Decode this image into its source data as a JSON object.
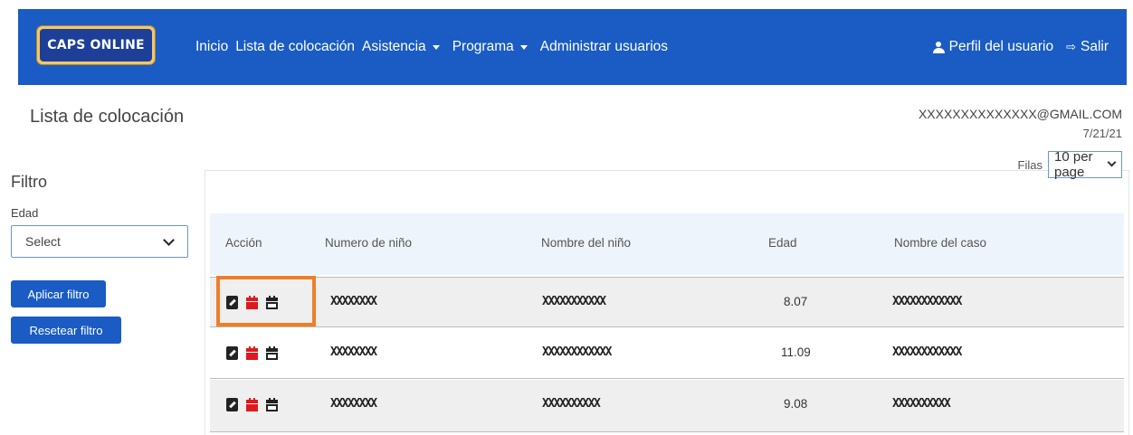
{
  "navbar": {
    "logo": "CAPS ONLINE",
    "links": [
      {
        "label": "Inicio",
        "dropdown": false
      },
      {
        "label": "Lista de colocación",
        "dropdown": false
      },
      {
        "label": "Asistencia",
        "dropdown": true
      },
      {
        "label": "Programa",
        "dropdown": true
      },
      {
        "label": "Administrar usuarios",
        "dropdown": false
      }
    ],
    "profile_label": "Perfil del usuario",
    "logout_label": "Salir",
    "color": "#1a5cc4"
  },
  "page": {
    "title": "Lista de colocación",
    "user_email": "XXXXXXXXXXXXXX@GMAIL.COM",
    "date": "7/21/21"
  },
  "filter": {
    "title": "Filtro",
    "age_label": "Edad",
    "age_select": "Select",
    "apply_button": "Aplicar filtro",
    "reset_button": "Resetear filtro"
  },
  "table": {
    "rows_label": "Filas",
    "rows_per_page": "10 per page",
    "columns": [
      "Acción",
      "Numero de niño",
      "Nombre del niño",
      "Edad",
      "Nombre del caso"
    ],
    "rows": [
      {
        "numero": "XXXXXXXX",
        "nombre": "XXXXXXXXXXX",
        "edad": "8.07",
        "caso": "XXXXXXXXXXXX"
      },
      {
        "numero": "XXXXXXXX",
        "nombre": "XXXXXXXXXXXX",
        "edad": "11.09",
        "caso": "XXXXXXXXXXXX"
      },
      {
        "numero": "XXXXXXXX",
        "nombre": "XXXXXXXXXX",
        "edad": "9.08",
        "caso": "XXXXXXXXXX"
      }
    ],
    "action_icons": [
      "edit-icon",
      "calendar-red-icon",
      "calendar-icon"
    ],
    "highlight_color": "#f07e26"
  }
}
